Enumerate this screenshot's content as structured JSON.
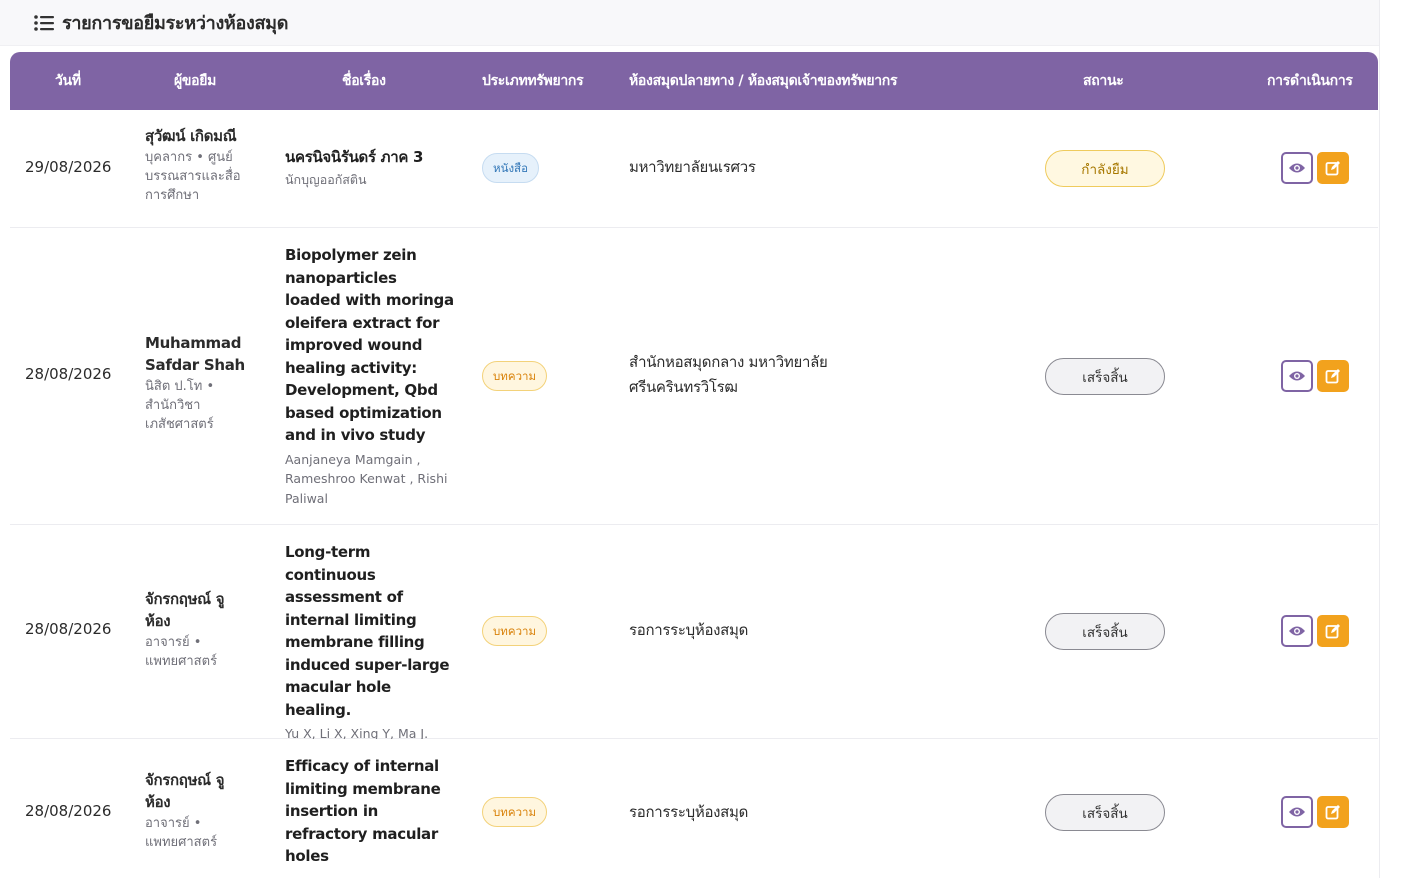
{
  "panel": {
    "title": "รายการขอยืมระหว่างห้องสมุด",
    "icon": "list-icon"
  },
  "table": {
    "headers": {
      "date": "วันที่",
      "requester": "ผู้ขอยืม",
      "title": "ชื่อเรื่อง",
      "type": "ประเภททรัพยากร",
      "library": "ห้องสมุดปลายทาง / ห้องสมุดเจ้าของทรัพยากร",
      "status": "สถานะ",
      "actions": "การดำเนินการ"
    },
    "rows": [
      {
        "date": "29/08/2026",
        "requester_name": "สุวัฒน์ เกิดมณี",
        "requester_info": "บุคลากร • ศูนย์บรรณสารและสื่อการศึกษา",
        "title": "นครนิจนิรันดร์ ภาค 3",
        "authors": "นักบุญออกัสติน",
        "type": "หนังสือ",
        "library": "มหาวิทยาลัยนเรศวร",
        "status": "กำลังยืม"
      },
      {
        "date": "28/08/2026",
        "requester_name": "Muhammad Safdar Shah",
        "requester_info": "นิสิต ป.โท • สำนักวิชาเภสัชศาสตร์",
        "title": "Biopolymer zein nanoparticles loaded with moringa oleifera extract for improved wound healing activity: Development, Qbd based optimization and in vivo study",
        "authors": "Aanjaneya Mamgain , Rameshroo Kenwat , Rishi Paliwal",
        "type": "บทความ",
        "library": "สำนักหอสมุดกลาง มหาวิทยาลัยศรีนครินทรวิโรฒ",
        "status": "เสร็จสิ้น"
      },
      {
        "date": "28/08/2026",
        "requester_name": "จักรกฤษณ์ จูห้อง",
        "requester_info": "อาจารย์ • แพทยศาสตร์",
        "title": "Long-term continuous assessment of internal limiting membrane filling induced super-large macular hole healing.",
        "authors": "Yu X, Li X, Xing Y, Ma J.",
        "type": "บทความ",
        "library": "รอการระบุห้องสมุด",
        "status": "เสร็จสิ้น"
      },
      {
        "date": "28/08/2026",
        "requester_name": "จักรกฤษณ์ จูห้อง",
        "requester_info": "อาจารย์ • แพทยศาสตร์",
        "title": "Efficacy of internal limiting membrane insertion in refractory macular holes",
        "authors": "",
        "type": "บทความ",
        "library": "รอการระบุห้องสมุด",
        "status": "เสร็จสิ้น"
      }
    ]
  },
  "icons": {
    "view": "eye-icon",
    "edit": "edit-icon"
  },
  "colors": {
    "header_bg": "#7f64a4",
    "edit_button": "#f2a21d",
    "status_active": "#a77800",
    "badge_book": "#3478b8",
    "badge_article": "#d9820a"
  }
}
